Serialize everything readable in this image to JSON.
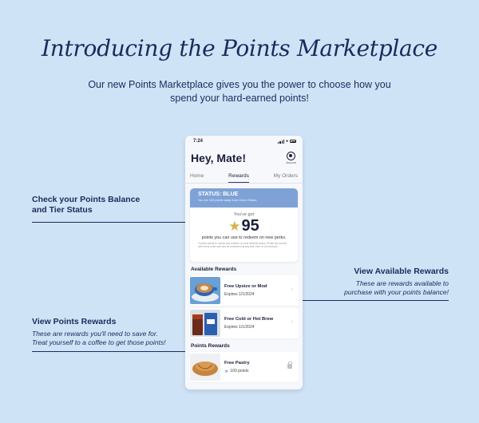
{
  "headline": "Introducing the Points Marketplace",
  "subhead": "Our new Points Marketplace gives you the power to choose how you spend your hard-earned points!",
  "callouts": {
    "balance": {
      "title": "Check your Points Balance and Tier Status"
    },
    "available": {
      "title": "View Available Rewards",
      "desc": "These are rewards available to purchase with your points balance!"
    },
    "points_rewards": {
      "title": "View Points Rewards",
      "desc": "These are rewards you'll need to save for. Treat yourself to a coffee to get those points!"
    }
  },
  "phone": {
    "time": "7:24",
    "greeting": "Hey, Mate!",
    "account_label": "Account",
    "tabs": [
      "Home",
      "Rewards",
      "My Orders"
    ],
    "status": {
      "title": "STATUS: BLUE",
      "subtitle": "You are 105 points away from Green Status",
      "got_label": "You've got",
      "points": "95",
      "redeem_text": "points you can use to redeem on new perks.",
      "fine_print": "*Collect points to unlock and redeem on new rewards below. Points are earned with every order and can be redeemed at any time here or at checkout."
    },
    "available_title": "Available Rewards",
    "available": [
      {
        "name": "Free Upsize or Mod",
        "sub": "Expires 1/1/2024"
      },
      {
        "name": "Free Cold or Hot Brew",
        "sub": "Expires 1/1/2024"
      }
    ],
    "points_title": "Points Rewards",
    "points_rewards": [
      {
        "name": "Free Pastry",
        "sub": "100 points"
      }
    ]
  },
  "colors": {
    "background": "#cfe3f6",
    "navy": "#1c2a5c",
    "status_blue": "#7ea2d6",
    "star_gold": "#d8b34d"
  }
}
